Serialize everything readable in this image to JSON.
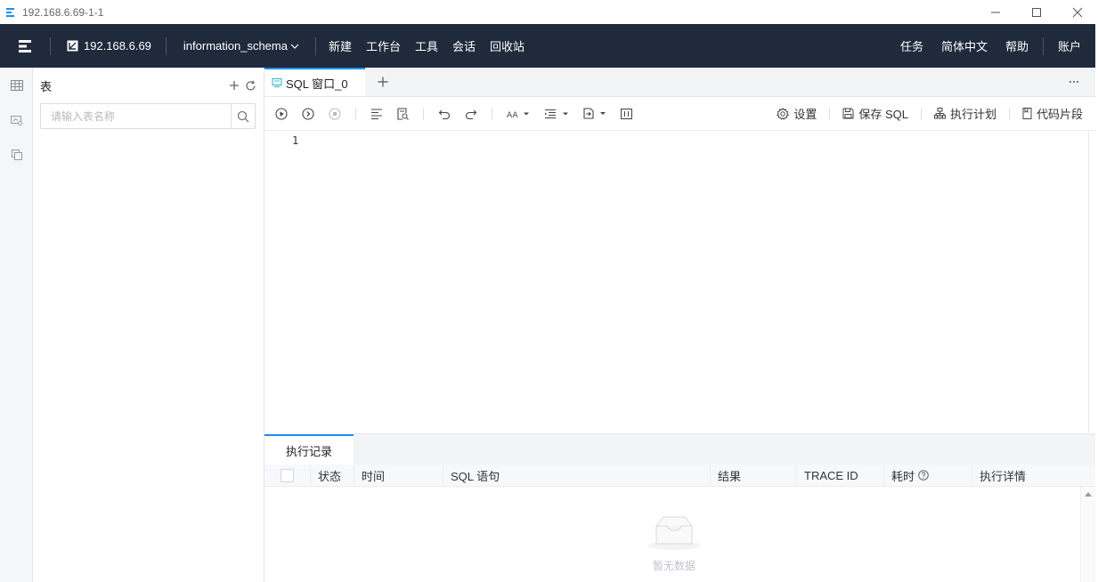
{
  "window": {
    "title": "192.168.6.69-1-1",
    "controls": [
      "minimize-icon",
      "maximize-icon",
      "close-icon"
    ]
  },
  "topnav": {
    "host": "192.168.6.69",
    "database": "information_schema",
    "menu": [
      "新建",
      "工作台",
      "工具",
      "会话",
      "回收站"
    ],
    "right": [
      "任务",
      "简体中文",
      "帮助",
      "账户"
    ]
  },
  "table_panel": {
    "title": "表",
    "search_placeholder": "请输入表名称"
  },
  "editor": {
    "tab_label": "SQL 窗口_0",
    "toolbar_right": {
      "settings": "设置",
      "save_sql": "保存 SQL",
      "exec_plan": "执行计划",
      "snippets": "代码片段"
    },
    "line_numbers": [
      "1"
    ]
  },
  "bottom": {
    "tab_label": "执行记录",
    "columns": [
      "状态",
      "时间",
      "SQL 语句",
      "结果",
      "TRACE ID",
      "耗时",
      "执行详情"
    ],
    "empty_text": "暂无数据"
  },
  "colors": {
    "nav_bg": "#1f2a3c",
    "accent": "#1f8ef1"
  }
}
